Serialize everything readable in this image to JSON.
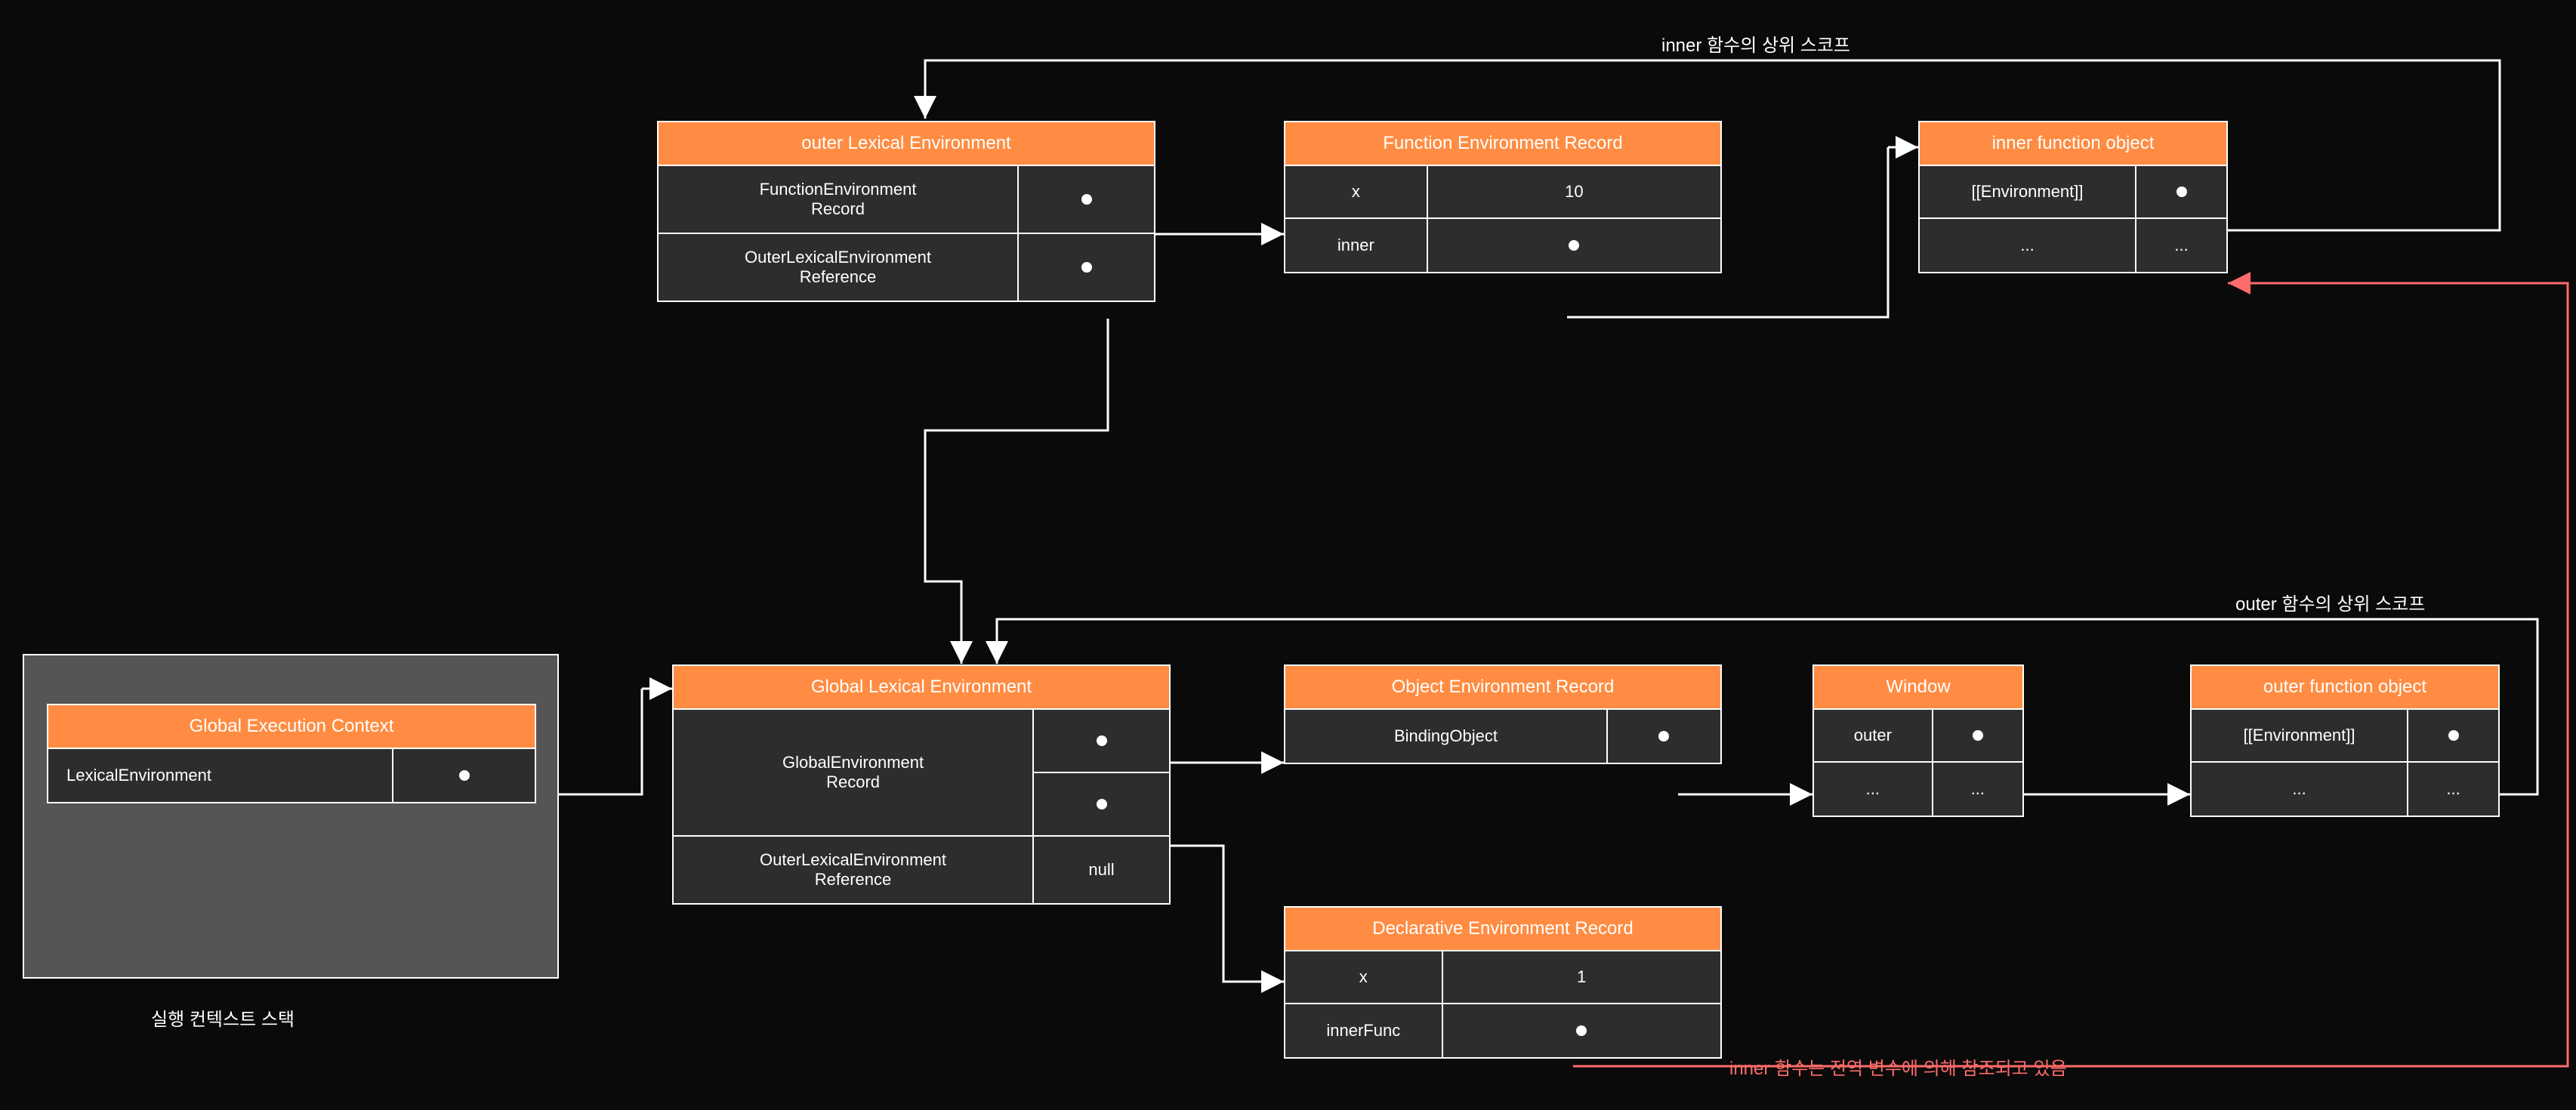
{
  "labels": {
    "inner_scope": "inner 함수의 상위 스코프",
    "outer_scope": "outer 함수의 상위 스코프",
    "stack_caption": "실행 컨텍스트 스택",
    "inner_ref_note": "inner 함수는 전역 변수에 의해 참조되고 있음"
  },
  "boxes": {
    "outer_lex_env": {
      "title": "outer Lexical Environment",
      "row1": "FunctionEnvironment\nRecord",
      "row2": "OuterLexicalEnvironment\nReference"
    },
    "func_env_rec": {
      "title": "Function Environment Record",
      "r1c1": "x",
      "r1c2": "10",
      "r2c1": "inner"
    },
    "inner_obj": {
      "title": "inner function object",
      "r1c1": "[[Environment]]",
      "r2c1": "...",
      "r2c2": "..."
    },
    "global_ctx": {
      "title": "Global Execution Context",
      "r1c1": "LexicalEnvironment"
    },
    "global_lex_env": {
      "title": "Global Lexical Environment",
      "row1": "GlobalEnvironment\nRecord",
      "row2": "OuterLexicalEnvironment\nReference",
      "row2_val": "null"
    },
    "obj_env_rec": {
      "title": "Object Environment Record",
      "r1c1": "BindingObject"
    },
    "window": {
      "title": "Window",
      "r1c1": "outer",
      "r2c1": "...",
      "r2c2": "..."
    },
    "outer_obj": {
      "title": "outer function object",
      "r1c1": "[[Environment]]",
      "r2c1": "...",
      "r2c2": "..."
    },
    "decl_env_rec": {
      "title": "Declarative Environment Record",
      "r1c1": "x",
      "r1c2": "1",
      "r2c1": "innerFunc"
    }
  }
}
